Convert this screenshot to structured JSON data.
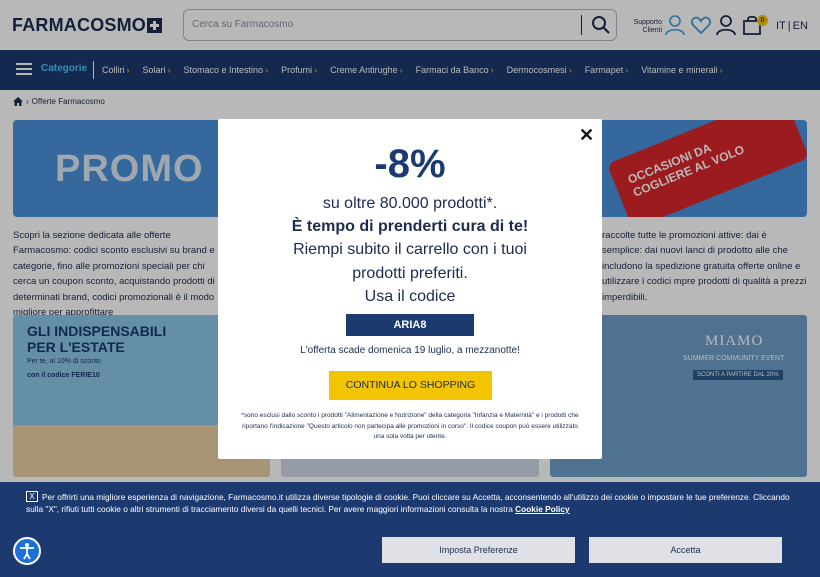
{
  "header": {
    "logo_text": "FARMACOSMO",
    "search_placeholder": "Cerca su Farmacosmo",
    "support_line1": "Supporto",
    "support_line2": "Clienti",
    "cart_count": "0",
    "lang_it": "IT",
    "lang_sep": "|",
    "lang_en": "EN"
  },
  "nav": {
    "categories_label": "Categorie",
    "items": [
      {
        "label": "Colliri"
      },
      {
        "label": "Solari"
      },
      {
        "label": "Stomaco e Intestino"
      },
      {
        "label": "Profumi"
      },
      {
        "label": "Creme Antirughe"
      },
      {
        "label": "Farmaci da Banco"
      },
      {
        "label": "Dermocosmesi"
      },
      {
        "label": "Farmapet"
      },
      {
        "label": "Vitamine e minerali"
      }
    ]
  },
  "breadcrumb": {
    "current": "Offerte Farmacosmo"
  },
  "page": {
    "banner_text": "PROMO",
    "tag_line1": "OCCASIONI DA",
    "tag_line2": "COGLIERE AL VOLO",
    "left_para": "Scopri la sezione dedicata alle offerte Farmacosmo: codici sconto esclusivi su brand e categorie, fino alle promozioni speciali per chi cerca un coupon sconto, acquistando prodotti di determinati brand, codici promozionali è il modo migliore per approfittare",
    "right_para": "raccolte tutte le promozioni attive: dai è semplice: dai nuovi lanci di prodotto alle che includono la spedizione gratuita offerte online e utilizzare i codici mpre prodotti di qualità a prezzi imperdibili.",
    "card1_title_line1": "GLI INDISPENSABILI",
    "card1_title_line2": "PER L'ESTATE",
    "card1_sub": "Per te, al 10% di sconto",
    "card1_code": "con il codice FERIE10",
    "card3_title": "MIAMO",
    "card3_sub": "SUMMER COMMUNITY EVENT",
    "card3_pill": "SCONTI A PARTIRE DAL 20%"
  },
  "modal": {
    "discount": "-8%",
    "line1": "su oltre 80.000 prodotti*.",
    "line2": "È tempo di prenderti cura di te!",
    "line3": "Riempi subito il carrello con i tuoi",
    "line4": "prodotti preferiti.",
    "line5": "Usa il codice",
    "code": "ARIA8",
    "expire": "L'offerta scade domenica 19 luglio, a mezzanotte!",
    "cta": "CONTINUA LO SHOPPING",
    "note": "*sono esclusi dallo sconto i prodotti \"Alimentazione e Nutrizione\" della categoria \"Infanzia e Maternità\" e i prodotti che riportano l'indicazione \"Questo articolo non partecipa alle promozioni in corso\". Il codice coupon può essere utilizzato una sola volta per utente.",
    "close": "✕"
  },
  "cookie": {
    "x_label": "X",
    "text": "Per offrirti una migliore esperienza di navigazione, Farmacosmo.it utilizza diverse tipologie di cookie. Puoi cliccare su Accetta, acconsentendo all'utilizzo dei cookie o impostare le tue preferenze. Cliccando sulla \"X\", rifiuti tutti cookie o altri strumenti di tracciamento diversi da quelli tecnici. Per avere maggiori informazioni consulta la nostra",
    "link": "Cookie Policy",
    "pref_button": "Imposta Preferenze",
    "accept_button": "Accetta"
  },
  "colors": {
    "brand_navy": "#1d3a70",
    "accent_yellow": "#f3c500",
    "accent_cyan": "#4fc3f7",
    "promo_red": "#d7262b"
  }
}
